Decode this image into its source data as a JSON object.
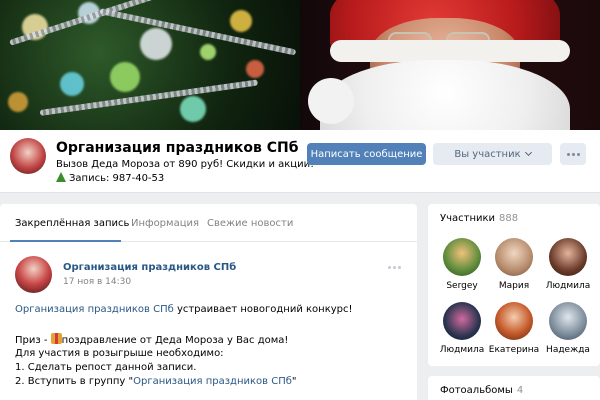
{
  "group": {
    "name": "Организация праздников СПб",
    "status": "Вызов Деда Мороза от 890 руб! Скидки и акции!",
    "phone": "Запись: 987-40-53"
  },
  "actions": {
    "message_button": "Написать сообщение",
    "member_button": "Вы участник"
  },
  "tabs": [
    {
      "label": "Закреплённая запись",
      "active": true
    },
    {
      "label": "Информация",
      "active": false
    },
    {
      "label": "Свежие новости",
      "active": false
    }
  ],
  "post": {
    "author": "Организация праздников СПб",
    "date": "17 ноя в 14:30",
    "line1_link": "Организация праздников СПб",
    "line1_rest": " устраивает новогодний конкурс!",
    "line2_prefix": "Приз - ",
    "line2_rest": "поздравление от Деда Мороза у Вас дома!",
    "line3": "Для участия в розыгрыше необходимо:",
    "line4": "1. Сделать репост данной записи.",
    "line5_prefix": "2. Вступить в группу \"",
    "line5_link": "Организация праздников СПб",
    "line5_suffix": "\""
  },
  "members": {
    "title": "Участники",
    "count": "888",
    "people": [
      {
        "name": "Sergey",
        "color": "#5b8a3a"
      },
      {
        "name": "Мария",
        "color": "#b58a6a"
      },
      {
        "name": "Людмила",
        "color": "#6b3a2a"
      },
      {
        "name": "Людмила",
        "color": "#2c3550"
      },
      {
        "name": "Екатерина",
        "color": "#c55a2a"
      },
      {
        "name": "Надежда",
        "color": "#7a8a9a"
      }
    ]
  },
  "albums": {
    "title": "Фотоальбомы",
    "count": "4"
  }
}
